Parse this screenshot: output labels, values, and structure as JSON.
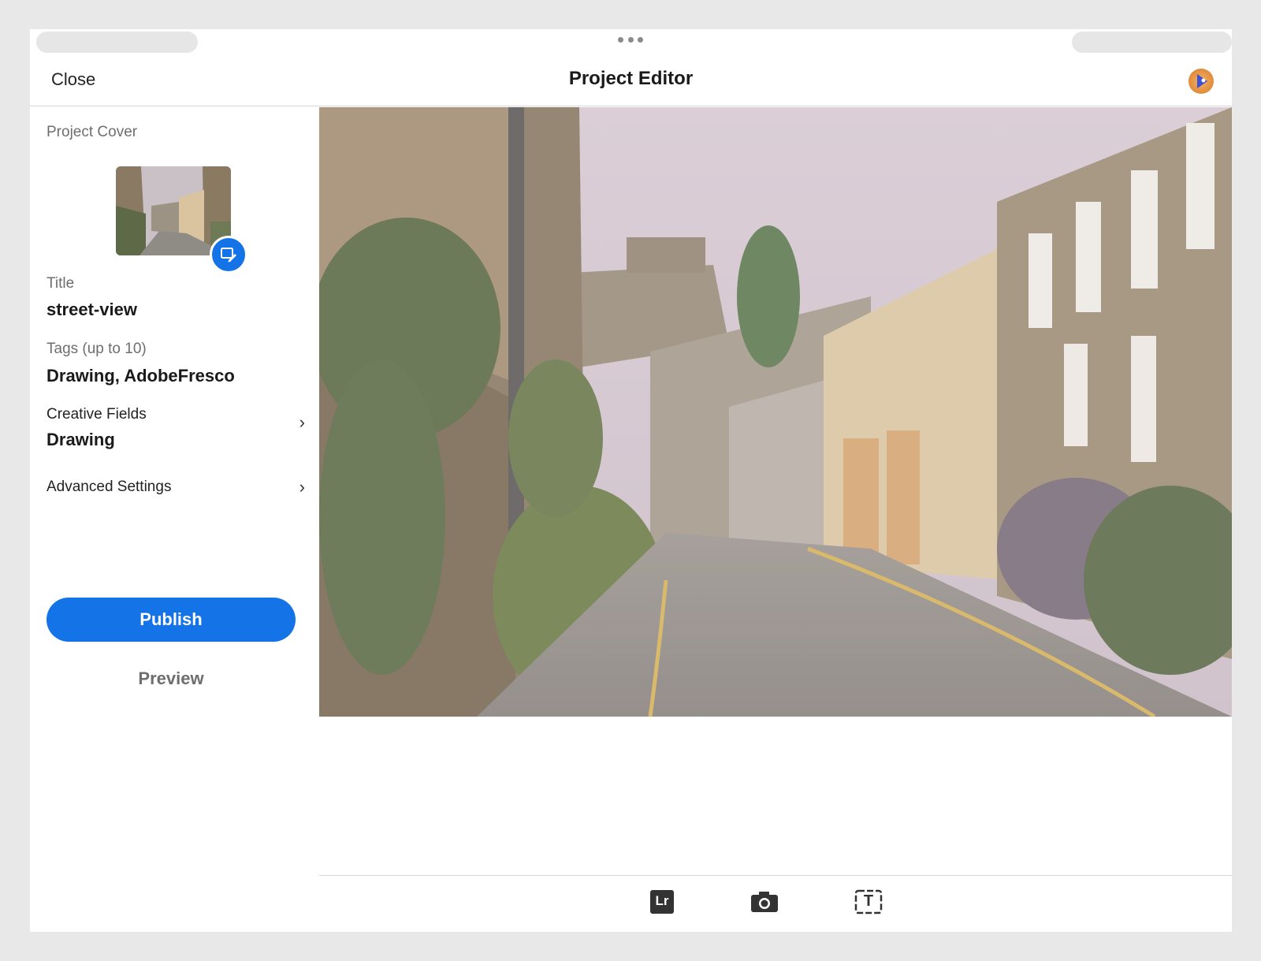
{
  "header": {
    "close_label": "Close",
    "title": "Project Editor",
    "avatar_icon": "user-avatar-icon"
  },
  "sidebar": {
    "cover_label": "Project Cover",
    "cover_edit_icon": "edit-cover-icon",
    "title_label": "Title",
    "title_value": "street-view",
    "tags_label": "Tags (up to 10)",
    "tags_value": "Drawing, AdobeFresco",
    "creative_fields_label": "Creative Fields",
    "creative_fields_value": "Drawing",
    "advanced_settings_label": "Advanced Settings",
    "chevron": "›"
  },
  "actions": {
    "publish_label": "Publish",
    "preview_label": "Preview"
  },
  "toolbar": {
    "lightroom_label": "Lr",
    "lightroom_icon": "lightroom-icon",
    "camera_icon": "camera-icon",
    "text_icon": "text-icon",
    "text_glyph": "T"
  },
  "colors": {
    "accent": "#1473e6",
    "background": "#e8e8e8"
  }
}
